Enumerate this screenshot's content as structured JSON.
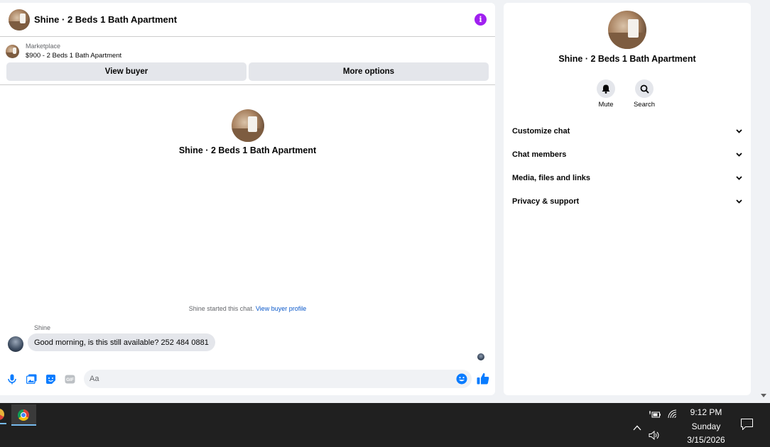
{
  "chat": {
    "header": {
      "title": "Shine · 2 Beds 1 Bath Apartment",
      "info_icon": "info-icon"
    },
    "listing": {
      "source": "Marketplace",
      "title": "$900 - 2 Beds 1 Bath Apartment"
    },
    "actions": {
      "view_buyer": "View buyer",
      "more_options": "More options"
    },
    "intro": {
      "name": "Shine · 2 Beds 1 Bath Apartment"
    },
    "started_note": {
      "text": "Shine started this chat.",
      "link": "View buyer profile"
    },
    "messages": [
      {
        "sender": "Shine",
        "text": "Good morning, is this still available? 252 484 0881"
      }
    ],
    "composer": {
      "placeholder": "Aa",
      "icons": [
        "microphone-icon",
        "photo-icon",
        "sticker-icon",
        "gif-icon",
        "emoji-icon",
        "thumbs-up-icon"
      ],
      "gif_label": "GIF"
    }
  },
  "info_panel": {
    "name": "Shine · 2 Beds 1 Bath Apartment",
    "actions": {
      "mute": "Mute",
      "search": "Search"
    },
    "sections": [
      "Customize chat",
      "Chat members",
      "Media, files and links",
      "Privacy & support"
    ]
  },
  "taskbar": {
    "clock": {
      "time": "9:12 PM",
      "day": "Sunday",
      "date": "3/15/2026"
    },
    "tray_icons": [
      "chevron-up-icon",
      "battery-icon",
      "wifi-icon",
      "volume-icon",
      "notification-icon"
    ]
  },
  "colors": {
    "accent": "#0a7cff",
    "info": "#a020f0",
    "taskbar": "#202020"
  }
}
